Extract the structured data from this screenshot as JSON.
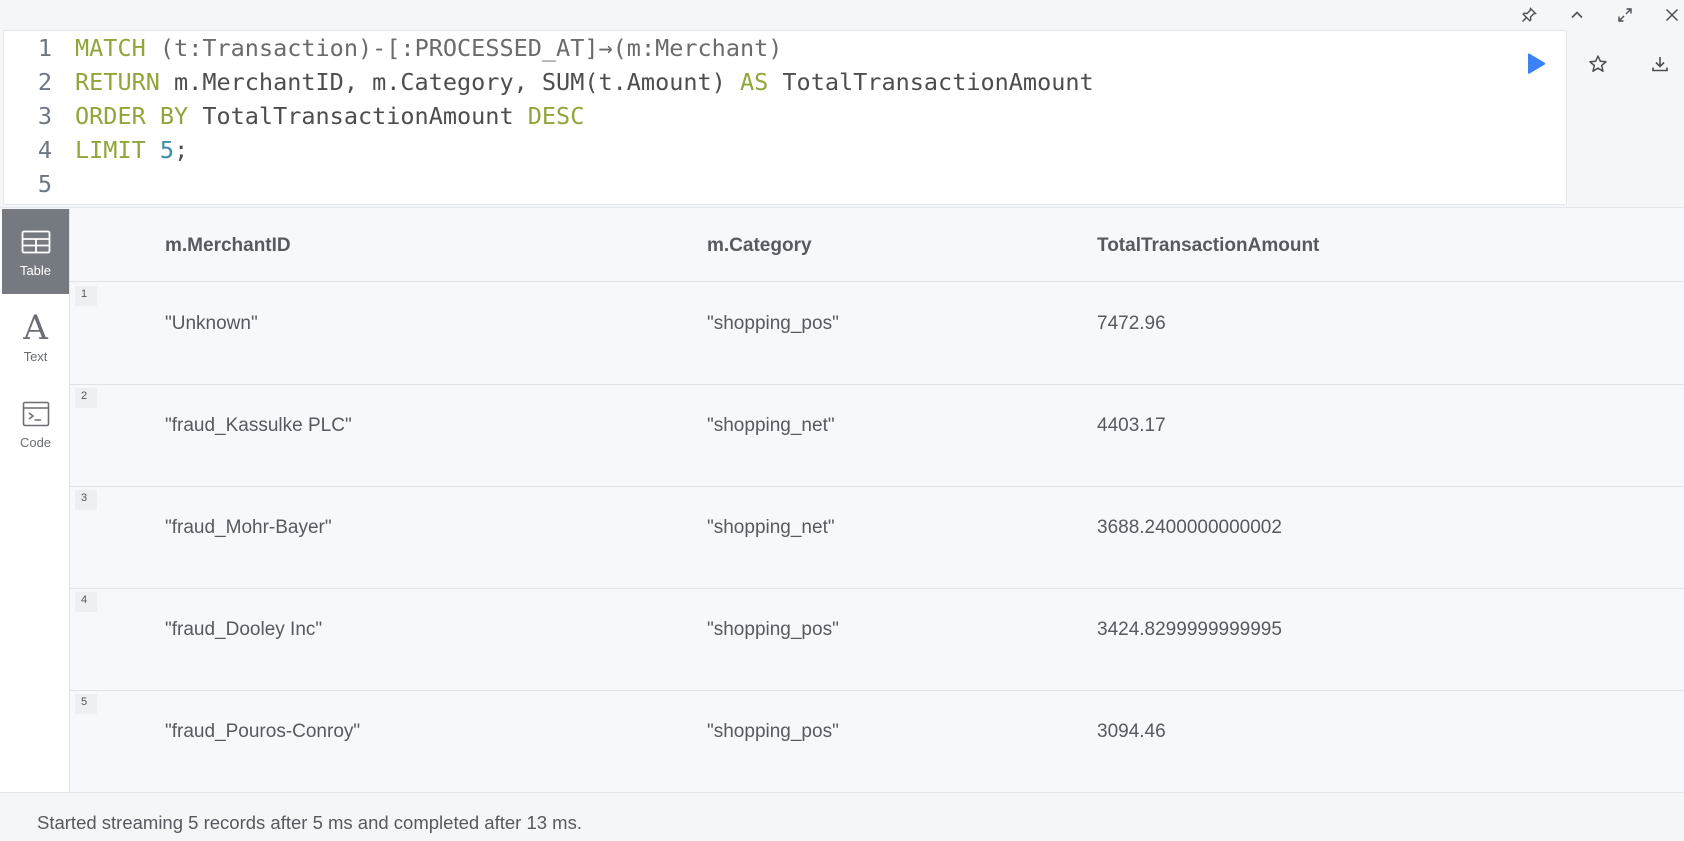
{
  "toolbar": {
    "icons": [
      "pin-icon",
      "chevron-up-icon",
      "expand-icon",
      "close-icon"
    ]
  },
  "editor": {
    "lines": [
      {
        "num": "1",
        "segments": [
          {
            "t": "MATCH",
            "c": "kw"
          },
          {
            "t": " ",
            "c": ""
          },
          {
            "t": "(t:Transaction)-[:PROCESSED_AT]→(m:Merchant)",
            "c": "punct"
          }
        ]
      },
      {
        "num": "2",
        "segments": [
          {
            "t": "RETURN",
            "c": "kw"
          },
          {
            "t": " m.MerchantID, m.Category, SUM(t.Amount) ",
            "c": ""
          },
          {
            "t": "AS",
            "c": "kw"
          },
          {
            "t": " TotalTransactionAmount",
            "c": ""
          }
        ]
      },
      {
        "num": "3",
        "segments": [
          {
            "t": "ORDER BY",
            "c": "kw"
          },
          {
            "t": " TotalTransactionAmount ",
            "c": ""
          },
          {
            "t": "DESC",
            "c": "kw"
          }
        ]
      },
      {
        "num": "4",
        "segments": [
          {
            "t": "LIMIT",
            "c": "kw"
          },
          {
            "t": " ",
            "c": ""
          },
          {
            "t": "5",
            "c": "num"
          },
          {
            "t": ";",
            "c": ""
          }
        ]
      },
      {
        "num": "5",
        "segments": []
      }
    ],
    "run_color": "#3b82f6"
  },
  "sidebar": {
    "tabs": [
      {
        "label": "Table",
        "icon": "table-icon",
        "active": true
      },
      {
        "label": "Text",
        "icon": "text-icon",
        "active": false
      },
      {
        "label": "Code",
        "icon": "code-icon",
        "active": false
      }
    ]
  },
  "table": {
    "columns": [
      "m.MerchantID",
      "m.Category",
      "TotalTransactionAmount"
    ],
    "rows": [
      {
        "idx": "1",
        "cells": [
          "\"Unknown\"",
          "\"shopping_pos\"",
          "7472.96"
        ]
      },
      {
        "idx": "2",
        "cells": [
          "\"fraud_Kassulke PLC\"",
          "\"shopping_net\"",
          "4403.17"
        ]
      },
      {
        "idx": "3",
        "cells": [
          "\"fraud_Mohr-Bayer\"",
          "\"shopping_net\"",
          "3688.2400000000002"
        ]
      },
      {
        "idx": "4",
        "cells": [
          "\"fraud_Dooley Inc\"",
          "\"shopping_pos\"",
          "3424.8299999999995"
        ]
      },
      {
        "idx": "5",
        "cells": [
          "\"fraud_Pouros-Conroy\"",
          "\"shopping_pos\"",
          "3094.46"
        ]
      }
    ]
  },
  "status": {
    "message": "Started streaming 5 records after 5 ms and completed after 13 ms."
  }
}
